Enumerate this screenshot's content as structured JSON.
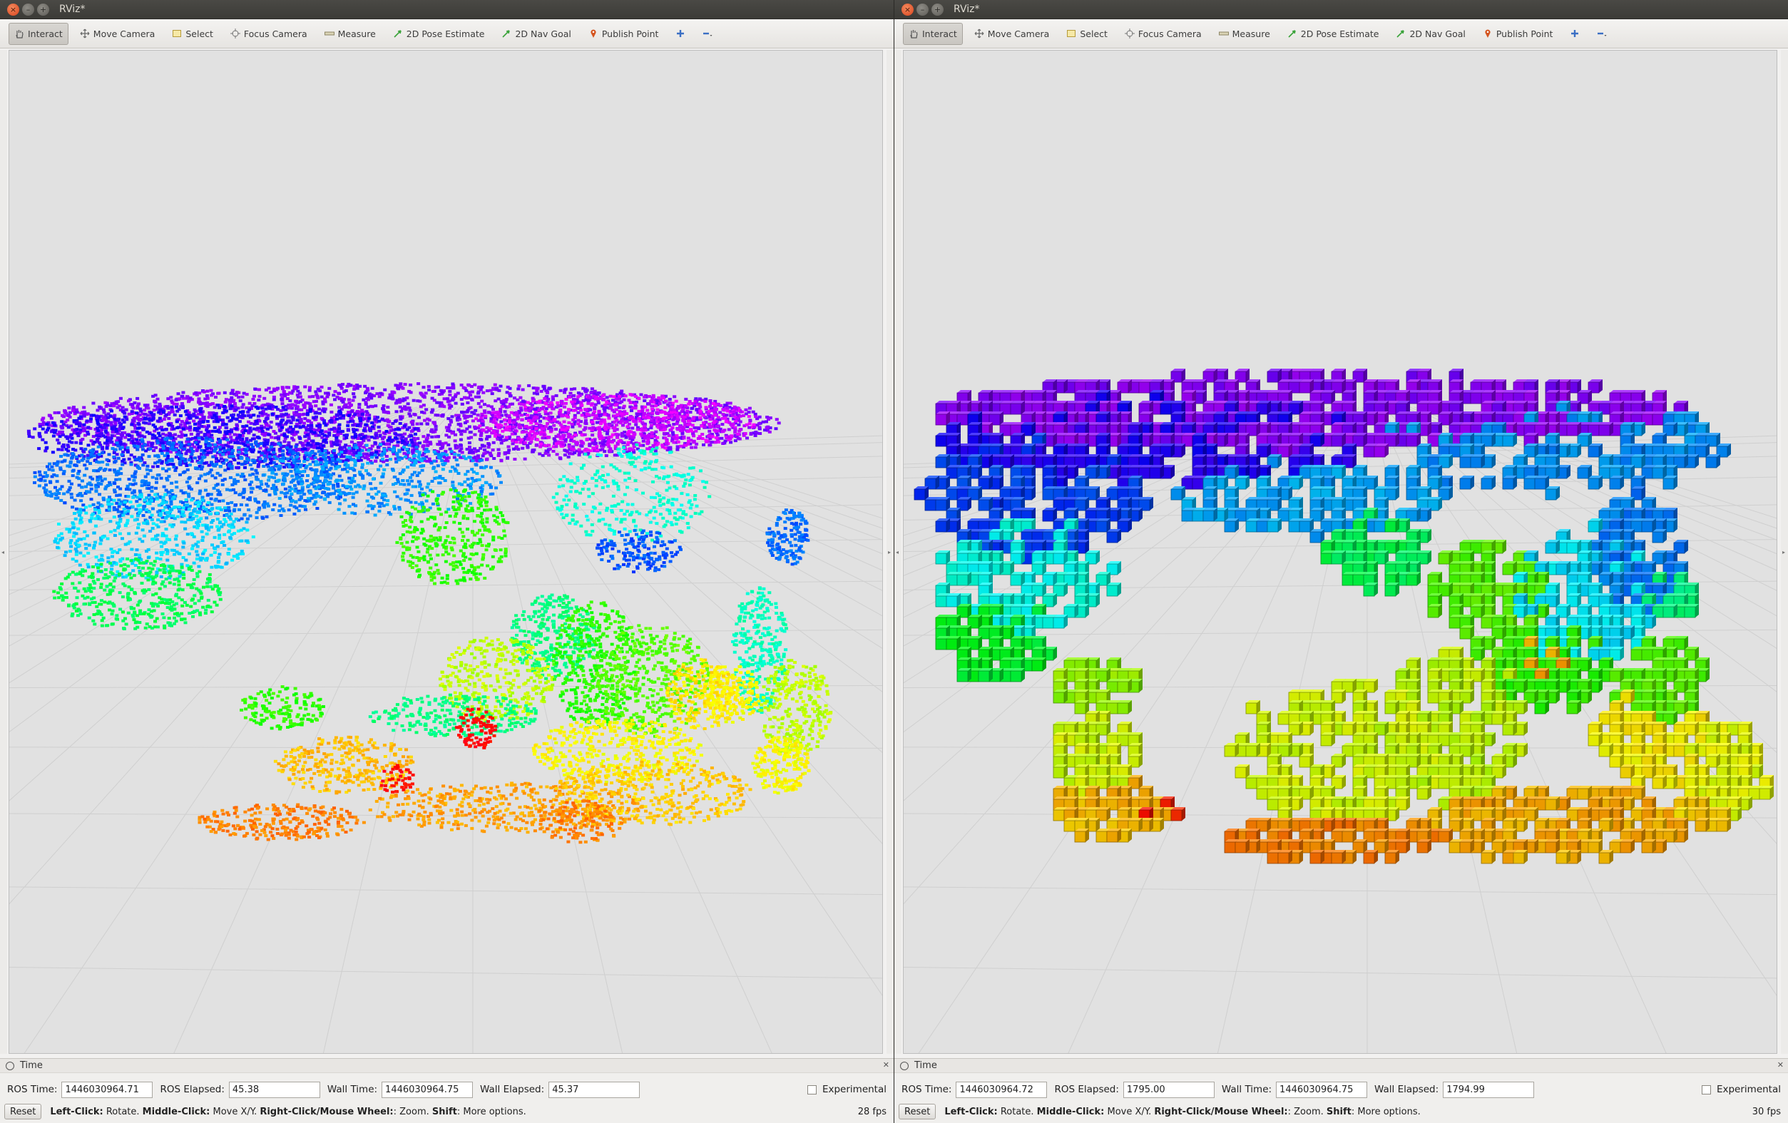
{
  "windows": [
    {
      "title": "RViz*",
      "toolbar": [
        {
          "label": "Interact",
          "icon": "hand-icon",
          "active": true
        },
        {
          "label": "Move Camera",
          "icon": "move-camera-icon"
        },
        {
          "label": "Select",
          "icon": "select-icon"
        },
        {
          "label": "Focus Camera",
          "icon": "focus-camera-icon"
        },
        {
          "label": "Measure",
          "icon": "ruler-icon"
        },
        {
          "label": "2D Pose Estimate",
          "icon": "pose-arrow-icon"
        },
        {
          "label": "2D Nav Goal",
          "icon": "nav-arrow-icon"
        },
        {
          "label": "Publish Point",
          "icon": "pin-icon"
        },
        {
          "label": "",
          "icon": "plus-icon"
        },
        {
          "label": "",
          "icon": "minus-dropdown-icon"
        }
      ],
      "time_panel": {
        "title": "Time",
        "ros_time_label": "ROS Time:",
        "ros_time": "1446030964.71",
        "ros_elapsed_label": "ROS Elapsed:",
        "ros_elapsed": "45.38",
        "wall_time_label": "Wall Time:",
        "wall_time": "1446030964.75",
        "wall_elapsed_label": "Wall Elapsed:",
        "wall_elapsed": "45.37",
        "experimental_label": "Experimental"
      },
      "status": {
        "reset_label": "Reset",
        "left_click": "Left-Click:",
        "left_click_desc": " Rotate. ",
        "middle_click": "Middle-Click:",
        "middle_click_desc": " Move X/Y. ",
        "right_click": "Right-Click/Mouse Wheel:",
        "right_click_desc": ": Zoom. ",
        "shift": "Shift",
        "shift_desc": ": More options.",
        "fps": "28 fps"
      },
      "view": "pointcloud"
    },
    {
      "title": "RViz*",
      "toolbar": [
        {
          "label": "Interact",
          "icon": "hand-icon",
          "active": true
        },
        {
          "label": "Move Camera",
          "icon": "move-camera-icon"
        },
        {
          "label": "Select",
          "icon": "select-icon"
        },
        {
          "label": "Focus Camera",
          "icon": "focus-camera-icon"
        },
        {
          "label": "Measure",
          "icon": "ruler-icon"
        },
        {
          "label": "2D Pose Estimate",
          "icon": "pose-arrow-icon"
        },
        {
          "label": "2D Nav Goal",
          "icon": "nav-arrow-icon"
        },
        {
          "label": "Publish Point",
          "icon": "pin-icon"
        },
        {
          "label": "",
          "icon": "plus-icon"
        },
        {
          "label": "",
          "icon": "minus-dropdown-icon"
        }
      ],
      "time_panel": {
        "title": "Time",
        "ros_time_label": "ROS Time:",
        "ros_time": "1446030964.72",
        "ros_elapsed_label": "ROS Elapsed:",
        "ros_elapsed": "1795.00",
        "wall_time_label": "Wall Time:",
        "wall_time": "1446030964.75",
        "wall_elapsed_label": "Wall Elapsed:",
        "wall_elapsed": "1794.99",
        "experimental_label": "Experimental"
      },
      "status": {
        "reset_label": "Reset",
        "left_click": "Left-Click:",
        "left_click_desc": " Rotate. ",
        "middle_click": "Middle-Click:",
        "middle_click_desc": " Move X/Y. ",
        "right_click": "Right-Click/Mouse Wheel:",
        "right_click_desc": ": Zoom. ",
        "shift": "Shift",
        "shift_desc": ": More options.",
        "fps": "30 fps"
      },
      "view": "voxels"
    }
  ],
  "colors": {
    "viewport_bg": "#e1e1e1",
    "grid": "#cfcfcf",
    "titlebar": "#3c3b37",
    "close_button": "#e9541f"
  }
}
